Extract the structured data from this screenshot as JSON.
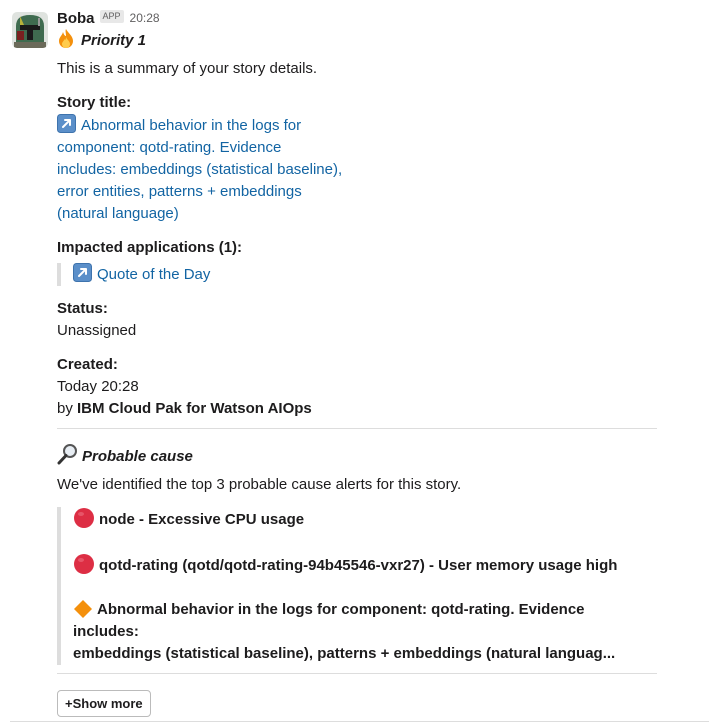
{
  "message": {
    "sender": "Boba",
    "badge": "APP",
    "timestamp": "20:28",
    "priority": "Priority 1",
    "summary": "This is a summary of your story details.",
    "story_title_label": "Story title:",
    "story_title_lines": [
      "Abnormal behavior in the logs for",
      "component: qotd-rating. Evidence",
      "includes: embeddings (statistical baseline),",
      "error entities, patterns + embeddings",
      "(natural language)"
    ],
    "impacted_label": "Impacted applications (1):",
    "impacted_app": "Quote of the Day",
    "status_label": "Status:",
    "status_value": "Unassigned",
    "created_label": "Created:",
    "created_value": "Today 20:28",
    "created_by_prefix": "by ",
    "created_by": "IBM Cloud Pak for Watson AIOps"
  },
  "probable_cause": {
    "title": "Probable cause",
    "intro": "We've identified the top 3 probable cause alerts for this story.",
    "alerts": [
      {
        "text": "node - Excessive CPU usage",
        "severity": "critical",
        "icon": "red-circle-icon"
      },
      {
        "text": "qotd-rating (qotd/qotd-rating-94b45546-vxr27) - User memory usage high",
        "severity": "critical",
        "icon": "red-circle-icon"
      },
      {
        "line1": "Abnormal behavior in the logs for component: qotd-rating. Evidence includes:",
        "line2": "embeddings (statistical baseline), patterns + embeddings (natural languag...",
        "severity": "warning",
        "icon": "orange-diamond-icon"
      }
    ]
  },
  "show_more_label": "+Show more",
  "colors": {
    "link": "#1264a3",
    "critical": "#dd2e44",
    "warning": "#f4900c",
    "text": "#1d1c1d"
  }
}
